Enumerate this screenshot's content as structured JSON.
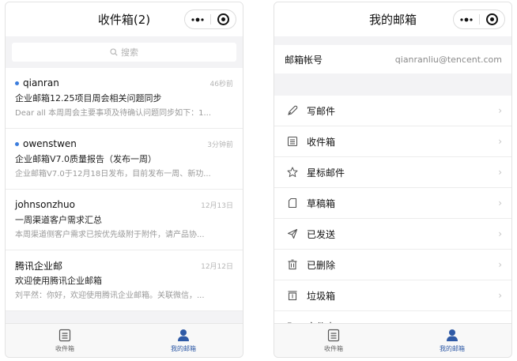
{
  "inbox": {
    "title": "收件箱(2)",
    "search_placeholder": "搜索",
    "mails": [
      {
        "sender": "qianran",
        "time": "46秒前",
        "subject": "企业邮箱12.25项目周会相关问题同步",
        "preview": "Dear all 本周周会主要事项及待确认问题同步如下：1...",
        "unread": true
      },
      {
        "sender": "owenstwen",
        "time": "3分钟前",
        "subject": "企业邮箱V7.0质量报告（发布一周）",
        "preview": "企业邮箱V7.0于12月18日发布，目前发布一周、新功...",
        "unread": true
      },
      {
        "sender": "johnsonzhuo",
        "time": "12月13日",
        "subject": "一周渠道客户需求汇总",
        "preview": "本周渠道侧客户需求已按优先级附于附件，请产品协...",
        "unread": false
      },
      {
        "sender": "腾讯企业邮",
        "time": "12月12日",
        "subject": "欢迎使用腾讯企业邮箱",
        "preview": "刘平然：你好，欢迎使用腾讯企业邮箱。关联微信，...",
        "unread": false
      }
    ]
  },
  "mailbox": {
    "title": "我的邮箱",
    "account_label": "邮箱帐号",
    "account_value": "qianranliu@tencent.com",
    "folders": [
      {
        "label": "写邮件",
        "icon": "pen-icon"
      },
      {
        "label": "收件箱",
        "icon": "inbox-icon"
      },
      {
        "label": "星标邮件",
        "icon": "star-icon"
      },
      {
        "label": "草稿箱",
        "icon": "draft-icon"
      },
      {
        "label": "已发送",
        "icon": "send-icon"
      },
      {
        "label": "已删除",
        "icon": "trash-icon"
      },
      {
        "label": "垃圾箱",
        "icon": "spam-icon"
      },
      {
        "label": "文件夹",
        "icon": "folder-icon"
      }
    ]
  },
  "tabbar": {
    "inbox_label": "收件箱",
    "mine_label": "我的邮箱"
  },
  "capsule": {
    "more": "•••"
  },
  "colors": {
    "accent": "#2f5aa6",
    "unread_dot": "#3b7ddd",
    "background": "#f3f3f5"
  }
}
